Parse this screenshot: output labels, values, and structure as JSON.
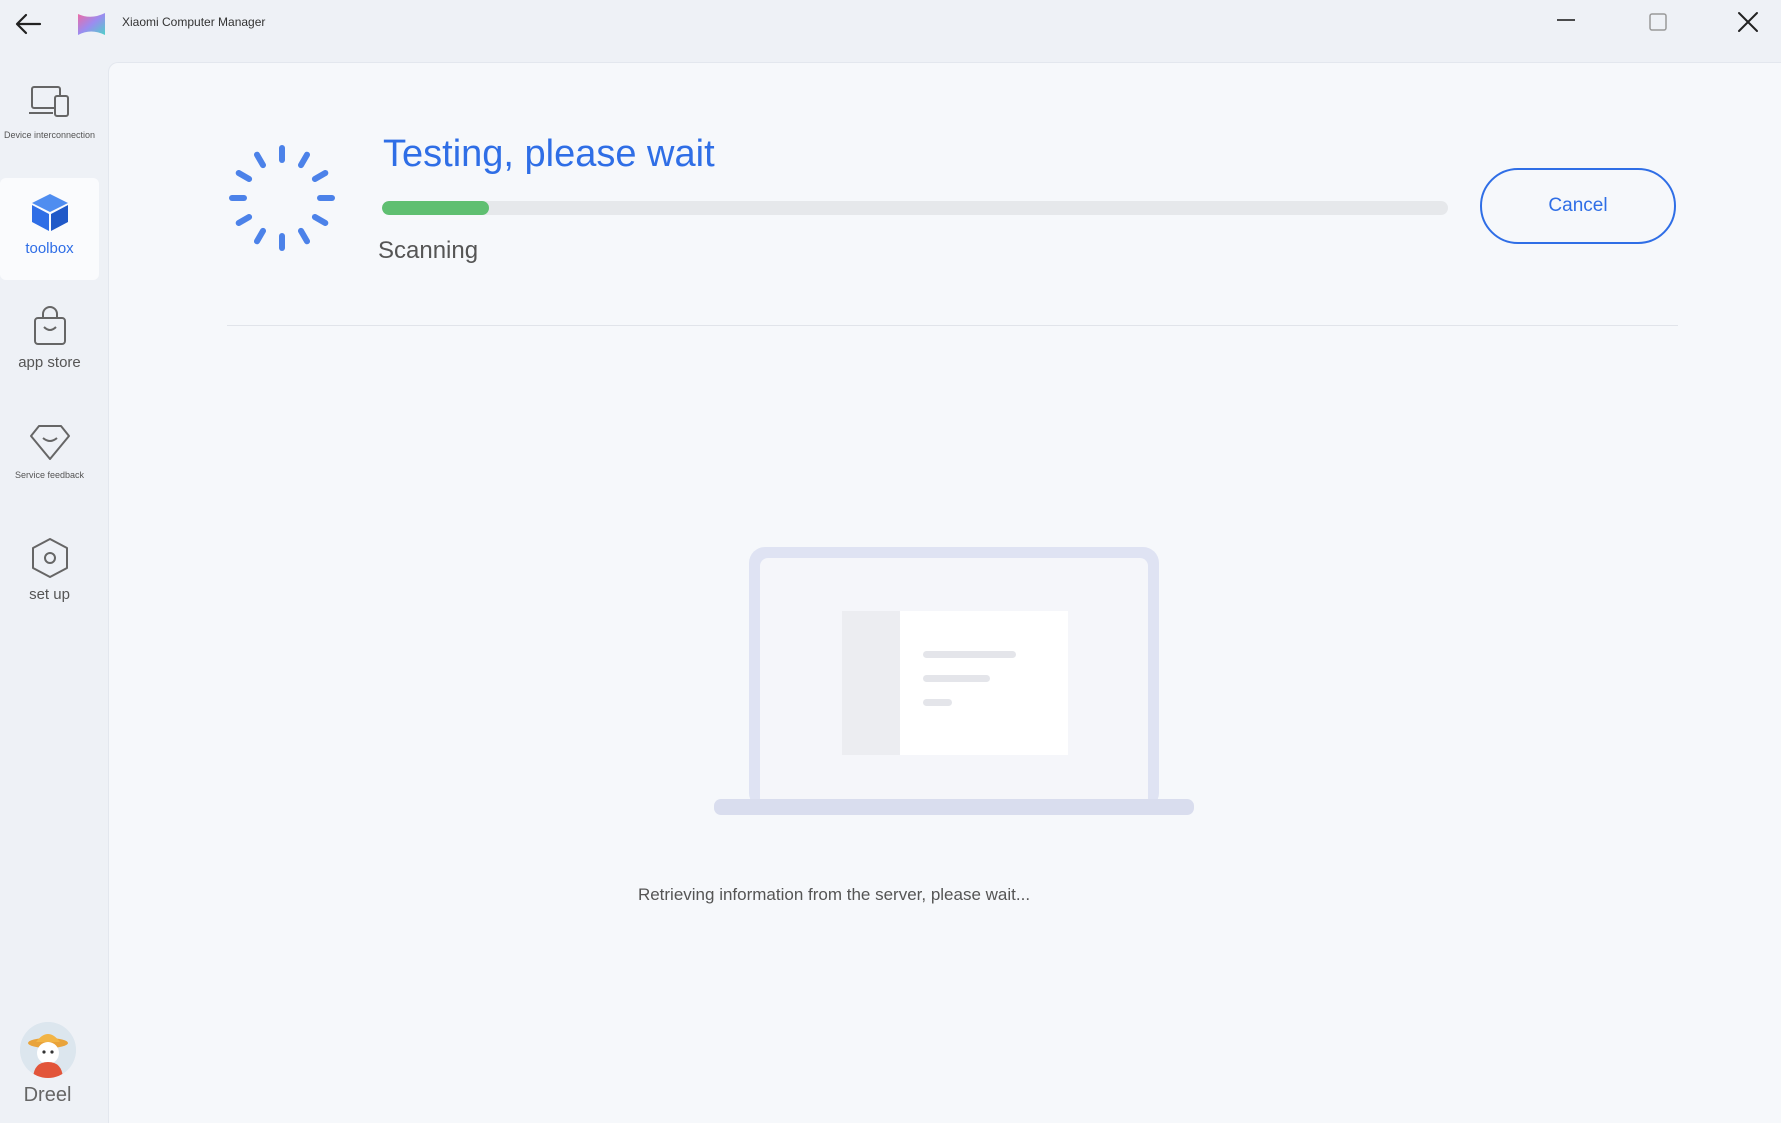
{
  "window": {
    "title": "Xiaomi Computer Manager"
  },
  "sidebar": {
    "items": [
      {
        "label": "Device interconnection",
        "icon": "device-icon",
        "active": false
      },
      {
        "label": "toolbox",
        "icon": "toolbox-icon",
        "active": true
      },
      {
        "label": "app store",
        "icon": "bag-icon",
        "active": false
      },
      {
        "label": "Service feedback",
        "icon": "feedback-icon",
        "active": false
      },
      {
        "label": "set up",
        "icon": "settings-icon",
        "active": false
      }
    ],
    "user": {
      "name": "Dreel"
    }
  },
  "main": {
    "status_title": "Testing, please wait",
    "status_sub": "Scanning",
    "progress": 0.1,
    "cancel_label": "Cancel",
    "wait_message": "Retrieving information from the server, please wait..."
  },
  "colors": {
    "accent": "#2f6ee6",
    "progress": "#5fbf71"
  }
}
